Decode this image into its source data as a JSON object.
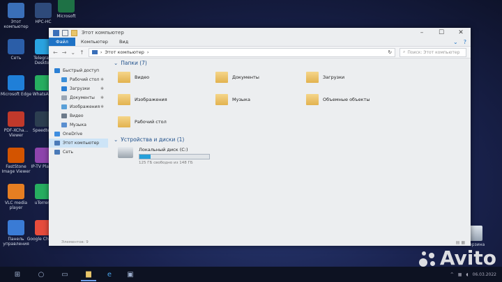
{
  "desktop": {
    "icons": [
      {
        "label": "Этот компьютер",
        "color": "#3a6fb8"
      },
      {
        "label": "Сеть",
        "color": "#2b5ea8"
      },
      {
        "label": "Microsoft Edge",
        "color": "#1f7fd8"
      },
      {
        "label": "PDF-XCha... Viewer",
        "color": "#c0392b"
      },
      {
        "label": "FastStone Image Viewer",
        "color": "#d35400"
      },
      {
        "label": "VLC media player",
        "color": "#e67e22"
      },
      {
        "label": "Панель управления",
        "color": "#3a7bd5"
      }
    ],
    "icons_col2": [
      {
        "label": "HPC-HC",
        "color": "#2e4a7a"
      },
      {
        "label": "Telegram Desktop",
        "color": "#2aa3e0"
      },
      {
        "label": "WhatsApp",
        "color": "#27ae60"
      },
      {
        "label": "Speedtest",
        "color": "#2c3e50"
      },
      {
        "label": "IP-TV Player",
        "color": "#8e44ad"
      },
      {
        "label": "uTorrent",
        "color": "#27ae60"
      },
      {
        "label": "Google Chrome",
        "color": "#e74c3c"
      }
    ],
    "icons_col3": [
      {
        "label": "Microsoft",
        "color": "#1e7145"
      }
    ],
    "recycle_label": "Корзина"
  },
  "window": {
    "title": "Этот компьютер",
    "ribbon": {
      "file": "Файл",
      "tabs": [
        "Компьютер",
        "Вид"
      ]
    },
    "address": {
      "path": "Этот компьютер",
      "search_placeholder": "Поиск: Этот компьютер"
    },
    "nav": [
      {
        "label": "Быстрый доступ",
        "sub": false,
        "color": "#2a7fd4",
        "pin": false
      },
      {
        "label": "Рабочий стол",
        "sub": true,
        "color": "#3b8fd9",
        "pin": true
      },
      {
        "label": "Загрузки",
        "sub": true,
        "color": "#2a7fd4",
        "pin": true
      },
      {
        "label": "Документы",
        "sub": true,
        "color": "#9aa6b5",
        "pin": true
      },
      {
        "label": "Изображения",
        "sub": true,
        "color": "#5aa0d8",
        "pin": true
      },
      {
        "label": "Видео",
        "sub": true,
        "color": "#6c7a8a",
        "pin": false
      },
      {
        "label": "Музыка",
        "sub": true,
        "color": "#5a8fd0",
        "pin": false
      },
      {
        "label": "OneDrive",
        "sub": false,
        "color": "#3d8de0",
        "pin": false
      },
      {
        "label": "Этот компьютер",
        "sub": false,
        "color": "#4a7ab8",
        "pin": false,
        "selected": true
      },
      {
        "label": "Сеть",
        "sub": false,
        "color": "#4a7ab8",
        "pin": false
      }
    ],
    "folders_header": "Папки (7)",
    "folders": [
      "Видео",
      "Документы",
      "Загрузки",
      "Изображения",
      "Музыка",
      "Объемные объекты",
      "Рабочий стол"
    ],
    "devices_header": "Устройства и диски (1)",
    "drive": {
      "name": "Локальный диск (C:)",
      "free_text": "125 ГБ свободно из 148 ГБ",
      "used_fraction": 0.16
    },
    "status": "Элементов: 9"
  },
  "tray": {
    "time": "",
    "date": "06.03.2022"
  },
  "watermark": "Avito"
}
